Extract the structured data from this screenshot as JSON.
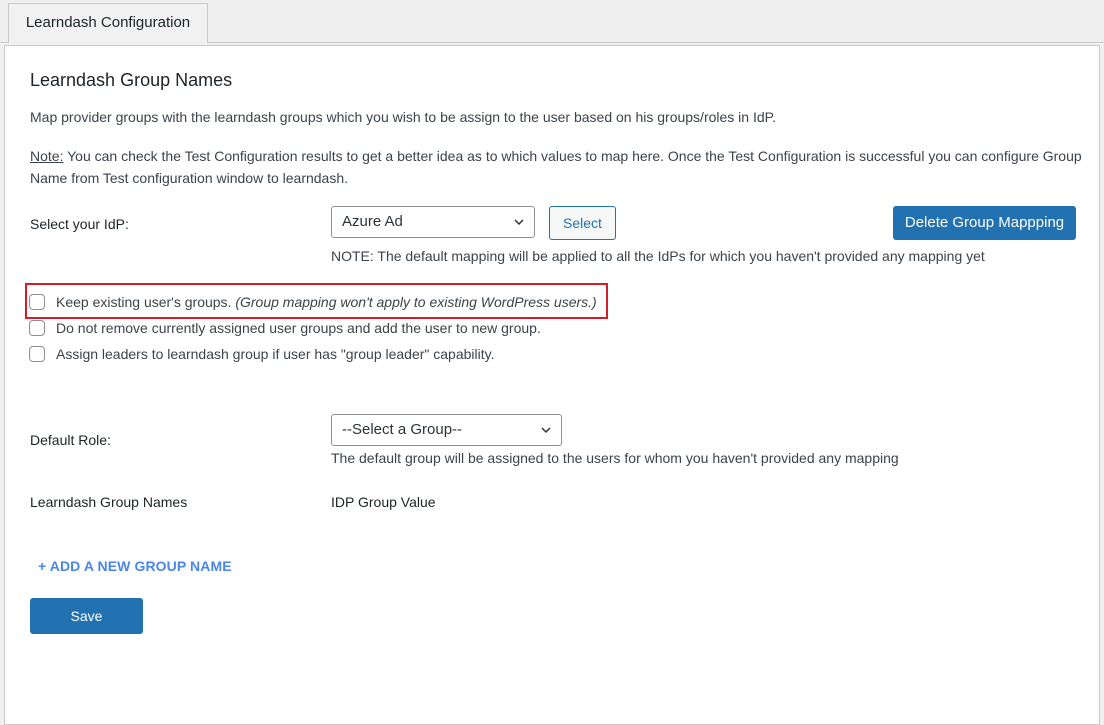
{
  "tabs": [
    {
      "label": "Learndash Configuration",
      "active": true
    }
  ],
  "section": {
    "title": "Learndash Group Names",
    "description": "Map provider groups with the learndash groups which you wish to be assign to the user based on his groups/roles in IdP.",
    "note_label": "Note:",
    "note_text": " You can check the Test Configuration results to get a better idea as to which values to map here. Once the Test Configuration is successful you can configure Group Name from Test configuration window to learndash."
  },
  "idp": {
    "label": "Select your IdP:",
    "selected": "Azure Ad",
    "select_button": "Select",
    "delete_button": "Delete Group Mappping",
    "note": "NOTE: The default mapping will be applied to all the IdPs for which you haven't provided any mapping yet"
  },
  "options": [
    {
      "label": "Keep existing user's groups.",
      "hint": "(Group mapping won't apply to existing WordPress users.)",
      "checked": false,
      "highlighted": true
    },
    {
      "label": "Do not remove currently assigned user groups and add the user to new group.",
      "hint": "",
      "checked": false,
      "highlighted": false
    },
    {
      "label": "Assign leaders to learndash group if user has \"group leader\" capability.",
      "hint": "",
      "checked": false,
      "highlighted": false
    }
  ],
  "default_role": {
    "label": "Default Role:",
    "selected": "--Select a Group--",
    "help": "The default group will be assigned to the users for whom you haven't provided any mapping"
  },
  "mapping_table": {
    "columns": [
      "Learndash Group Names",
      "IDP Group Value"
    ]
  },
  "add_link": "+ ADD A NEW GROUP NAME",
  "save_button": "Save",
  "colors": {
    "primary": "#2271b1",
    "link": "#4a86e8",
    "highlight": "#d11e2a"
  }
}
